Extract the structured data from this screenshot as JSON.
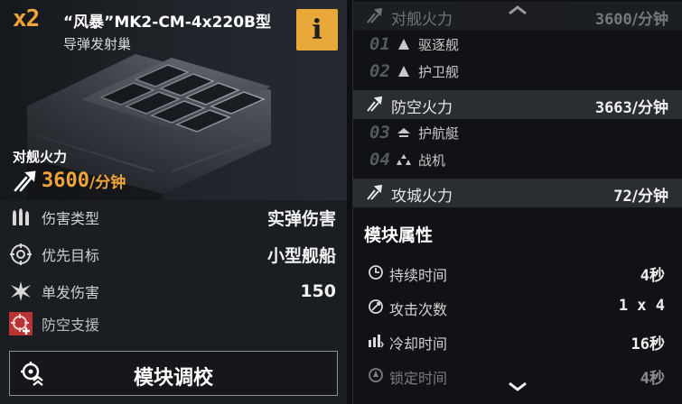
{
  "module": {
    "count": "x2",
    "title": "“风暴”MK2-CM-4x220B型",
    "subtitle": "导弹发射巢",
    "info_label": "i",
    "firepower_label": "对舰火力",
    "firepower_value": "3600",
    "firepower_unit": "/分钟"
  },
  "stats": [
    {
      "icon": "shells-icon",
      "label": "伤害类型",
      "value": "实弹伤害"
    },
    {
      "icon": "crosshair-icon",
      "label": "优先目标",
      "value": "小型舰船"
    },
    {
      "icon": "burst-icon",
      "label": "单发伤害",
      "value": "150"
    },
    {
      "icon": "anti-air-support-icon",
      "label": "防空支援",
      "value": ""
    }
  ],
  "calibrate_button": {
    "icon": "calibrate-icon",
    "label": "模块调校"
  },
  "firepower_bands": {
    "ship": {
      "label": "对舰火力",
      "value": "3600",
      "unit": "/分钟"
    },
    "antiair": {
      "label": "防空火力",
      "value": "3663",
      "unit": "/分钟"
    },
    "siege": {
      "label": "攻城火力",
      "value": "72",
      "unit": "/分钟"
    }
  },
  "targets": [
    {
      "num": "01",
      "icon": "destroyer-icon",
      "label": "驱逐舰"
    },
    {
      "num": "02",
      "icon": "frigate-icon",
      "label": "护卫舰"
    },
    {
      "num": "03",
      "icon": "corvette-icon",
      "label": "护航艇"
    },
    {
      "num": "04",
      "icon": "fighter-icon",
      "label": "战机"
    }
  ],
  "attributes_title": "模块属性",
  "attributes": [
    {
      "icon": "clock-icon",
      "label": "持续时间",
      "value": "4秒"
    },
    {
      "icon": "attack-count-icon",
      "label": "攻击次数",
      "value": "1 x 4"
    },
    {
      "icon": "cooldown-icon",
      "label": "冷却时间",
      "value": "16秒"
    },
    {
      "icon": "lock-on-icon",
      "label": "锁定时间",
      "value": "4秒"
    }
  ],
  "colors": {
    "accent": "#f0a43a",
    "info_bg": "#e9a83a",
    "band_bg": "#2a2d32"
  }
}
